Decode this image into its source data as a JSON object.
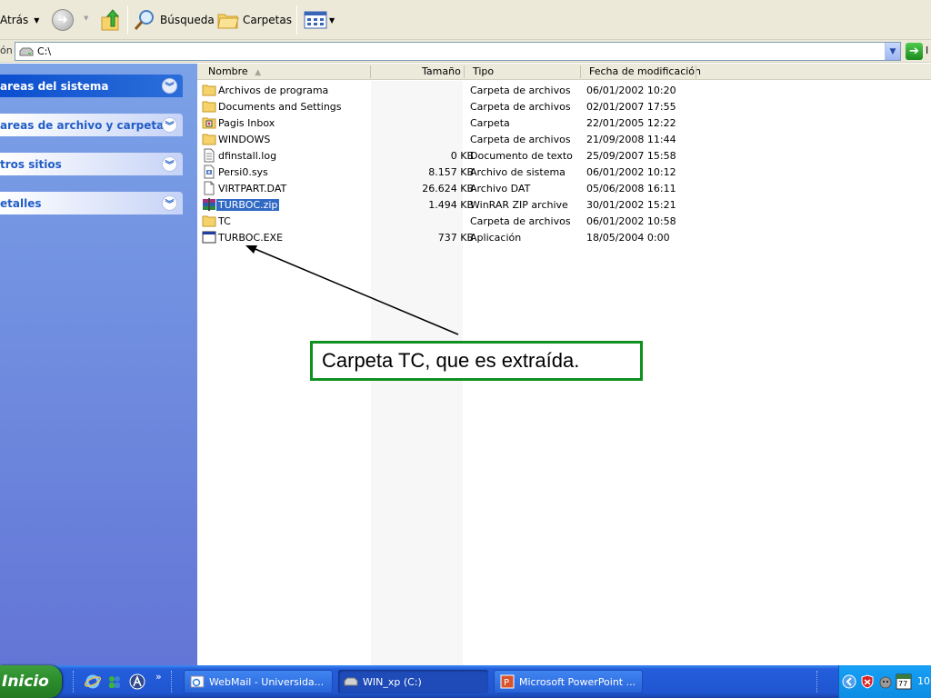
{
  "toolbar": {
    "back_label": "Atrás",
    "search_label": "Búsqueda",
    "folders_label": "Carpetas"
  },
  "address": {
    "label": "ón",
    "path": "C:\\",
    "go_label": "I"
  },
  "sidebar": {
    "panels": [
      {
        "label": "areas del sistema"
      },
      {
        "label": "areas de archivo y carpeta"
      },
      {
        "label": "tros sitios"
      },
      {
        "label": "etalles"
      }
    ]
  },
  "columns": {
    "name": "Nombre",
    "size": "Tamaño",
    "type": "Tipo",
    "date": "Fecha de modificación"
  },
  "files": [
    {
      "name": "Archivos de programa",
      "size": "",
      "type": "Carpeta de archivos",
      "date": "06/01/2002 10:20",
      "icon": "folder-icon"
    },
    {
      "name": "Documents and Settings",
      "size": "",
      "type": "Carpeta de archivos",
      "date": "02/01/2007 17:55",
      "icon": "folder-icon"
    },
    {
      "name": "Pagis Inbox",
      "size": "",
      "type": "Carpeta",
      "date": "22/01/2005 12:22",
      "icon": "special-folder-icon"
    },
    {
      "name": "WINDOWS",
      "size": "",
      "type": "Carpeta de archivos",
      "date": "21/09/2008 11:44",
      "icon": "folder-icon"
    },
    {
      "name": "dfinstall.log",
      "size": "0 KB",
      "type": "Documento de texto",
      "date": "25/09/2007 15:58",
      "icon": "text-file-icon"
    },
    {
      "name": "Persi0.sys",
      "size": "8.157 KB",
      "type": "Archivo de sistema",
      "date": "06/01/2002 10:12",
      "icon": "system-file-icon"
    },
    {
      "name": "VIRTPART.DAT",
      "size": "26.624 KB",
      "type": "Archivo DAT",
      "date": "05/06/2008 16:11",
      "icon": "generic-file-icon"
    },
    {
      "name": "TURBOC.zip",
      "size": "1.494 KB",
      "type": "WinRAR ZIP archive",
      "date": "30/01/2002 15:21",
      "icon": "rar-archive-icon",
      "selected": true
    },
    {
      "name": "TC",
      "size": "",
      "type": "Carpeta de archivos",
      "date": "06/01/2002 10:58",
      "icon": "folder-icon"
    },
    {
      "name": "TURBOC.EXE",
      "size": "737 KB",
      "type": "Aplicación",
      "date": "18/05/2004 0:00",
      "icon": "application-icon"
    }
  ],
  "annotation": {
    "text": "Carpeta TC, que es extraída."
  },
  "taskbar": {
    "start_label": "Inicio",
    "tasks": [
      {
        "label": "WebMail - Universida..."
      },
      {
        "label": "WIN_xp (C:)"
      },
      {
        "label": "Microsoft PowerPoint ..."
      }
    ],
    "tray_badge": "77",
    "clock": "10:"
  },
  "colors": {
    "selection": "#316ac5",
    "callout_border": "#109020",
    "taskbar": "#245edc",
    "start": "#2d8f2d"
  }
}
